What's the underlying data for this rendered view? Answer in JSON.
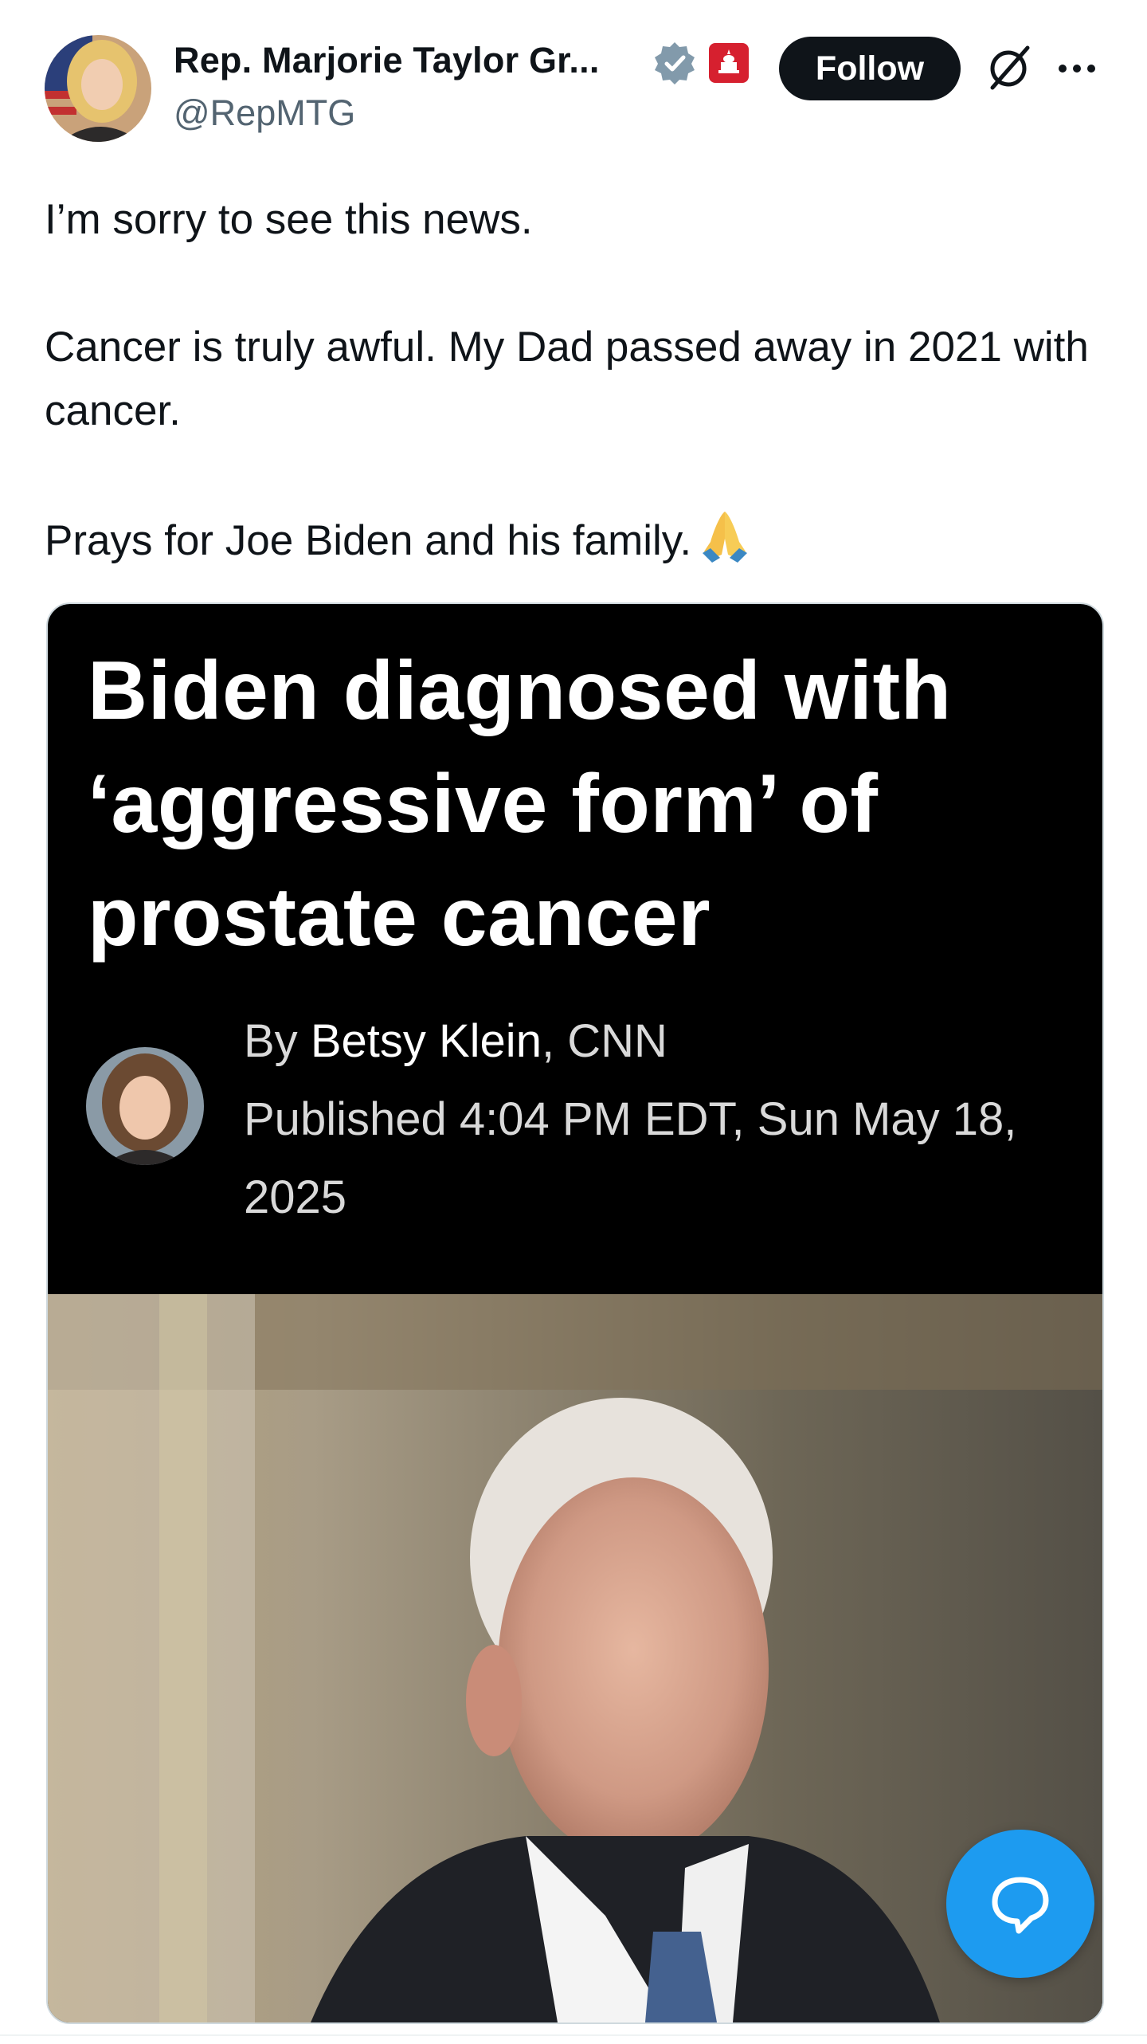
{
  "author": {
    "display_name": "Rep. Marjorie Taylor Gr...",
    "handle": "@RepMTG",
    "verified_icon": "verified-badge-icon",
    "affiliation_icon": "government-badge-icon"
  },
  "actions": {
    "follow_label": "Follow",
    "grok_icon": "grok-icon",
    "more_icon": "more-options-icon"
  },
  "tweet": {
    "paragraphs": [
      "I’m sorry to see this news.",
      "Cancer is truly awful.  My Dad passed away in 2021 with cancer.",
      "Prays for Joe Biden and his family."
    ],
    "emoji": "folded-hands-emoji"
  },
  "card": {
    "headline": "Biden diagnosed with ‘aggressive form’ of prostate cancer",
    "byline_prefix": "By ",
    "author": "Betsy Klein",
    "outlet": ", CNN",
    "published": "Published 4:04 PM EDT, Sun May 18, 2025"
  },
  "fab": {
    "icon": "reply-bubble-icon"
  },
  "colors": {
    "brand_blue": "#1d9bf0",
    "text": "#0f1419",
    "secondary": "#536471",
    "gov_red": "#d6202f"
  }
}
